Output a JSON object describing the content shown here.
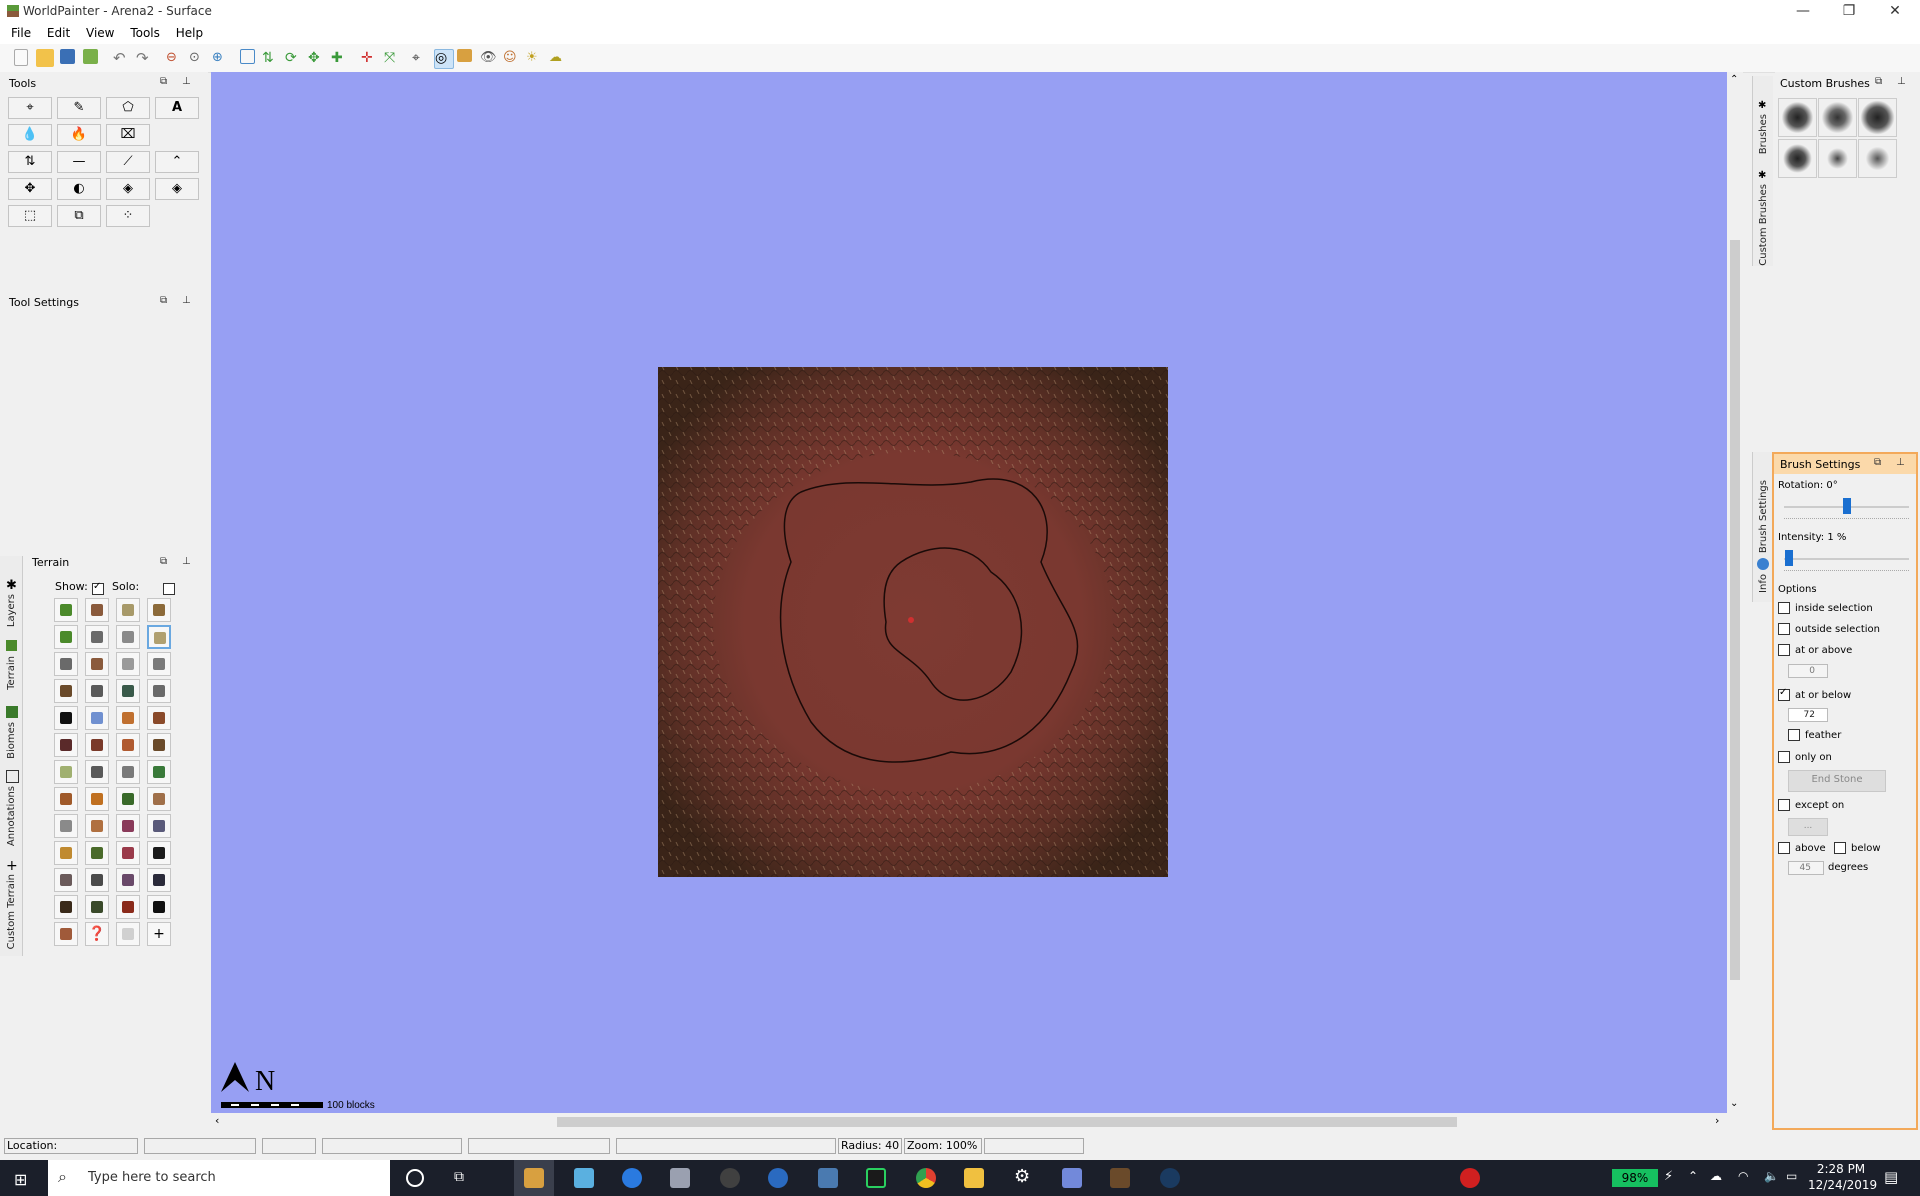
{
  "window": {
    "title": "WorldPainter - Arena2 - Surface",
    "min_glyph": "—",
    "max_glyph": "❐",
    "close_glyph": "✕"
  },
  "menu": [
    "File",
    "Edit",
    "View",
    "Tools",
    "Help"
  ],
  "tools_panel": {
    "title": "Tools",
    "buttons": [
      "⌖",
      "✎",
      "⬠",
      "A",
      "💧",
      "🔥",
      "⌧",
      "⇅",
      "—",
      "⟋",
      "⌃",
      "✥",
      "◐",
      "◈",
      "◈",
      "⬚",
      "⧉",
      "⁘"
    ]
  },
  "tool_settings_panel": {
    "title": "Tool Settings"
  },
  "terrain_panel": {
    "title": "Terrain",
    "show_label": "Show:",
    "solo_label": "Solo:",
    "tiles": [
      "#4b8a2b",
      "#8a5a3c",
      "#a89a6a",
      "#8c6a3a",
      "#4b8a2b",
      "#6a6a6a",
      "#8a8a8a",
      "#b0a070",
      "#6a6a6a",
      "#8a5a3c",
      "#9a9a9a",
      "#7a7a7a",
      "#6a4a2a",
      "#5a5a5a",
      "#3a5a4a",
      "#6a6a6a",
      "#111111",
      "#7090d0",
      "#c07030",
      "#8a4a2a",
      "#5a2a2a",
      "#7a3a2a",
      "#b05a30",
      "#6a4a2a",
      "#a0b070",
      "#5a5a5a",
      "#7a7a7a",
      "#3a7a3a",
      "#a05a2a",
      "#c07020",
      "#3a6a2a",
      "#a0704a",
      "#8a8a8a",
      "#b07040",
      "#8a3a5a",
      "#5a5a7a",
      "#c08a30",
      "#4a6a2a",
      "#9a3a4a",
      "#1a1a1a",
      "#6a5a5a",
      "#4a4a4a",
      "#6a4a6a",
      "#2a2a3a",
      "#3a2a1a",
      "#3a4a2a",
      "#8a2a1a",
      "#111111"
    ],
    "last_row": [
      "#a05a3a",
      "❓",
      "#d0d0d0",
      "+"
    ]
  },
  "side_tabs_left": [
    "Layers",
    "Terrain",
    "Biomes",
    "Annotations",
    "Custom Terrain"
  ],
  "side_tabs_right": [
    "Brushes",
    "Custom Brushes",
    "Brush Settings",
    "Info"
  ],
  "custom_brushes": {
    "title": "Custom Brushes"
  },
  "brush_settings": {
    "title": "Brush Settings",
    "rotation_label": "Rotation: 0°",
    "rotation_value_fraction": 0.5,
    "intensity_label": "Intensity: 1 %",
    "intensity_value_fraction": 0.01,
    "options_label": "Options",
    "inside_selection": "inside selection",
    "outside_selection": "outside selection",
    "at_or_above": "at or above",
    "at_or_above_value": "0",
    "at_or_below": "at or below",
    "at_or_below_value": "72",
    "feather": "feather",
    "only_on": "only on",
    "only_on_value": "End Stone",
    "except_on": "except on",
    "except_on_value": "...",
    "above": "above",
    "below": "below",
    "degrees_value": "45",
    "degrees_label": "degrees"
  },
  "scale": {
    "north": "N",
    "label": "100 blocks"
  },
  "status": {
    "location": "Location:",
    "radius": "Radius: 40",
    "zoom": "Zoom: 100%"
  },
  "taskbar": {
    "search_placeholder": "Type here to search",
    "battery": "98%",
    "time": "2:28 PM",
    "date": "12/24/2019"
  },
  "colors": {
    "canvas_bg": "#979ff3",
    "map_base": "#7d3a32",
    "accent_orange": "#f3a95a",
    "taskbar_bg": "#1b1f2a"
  }
}
